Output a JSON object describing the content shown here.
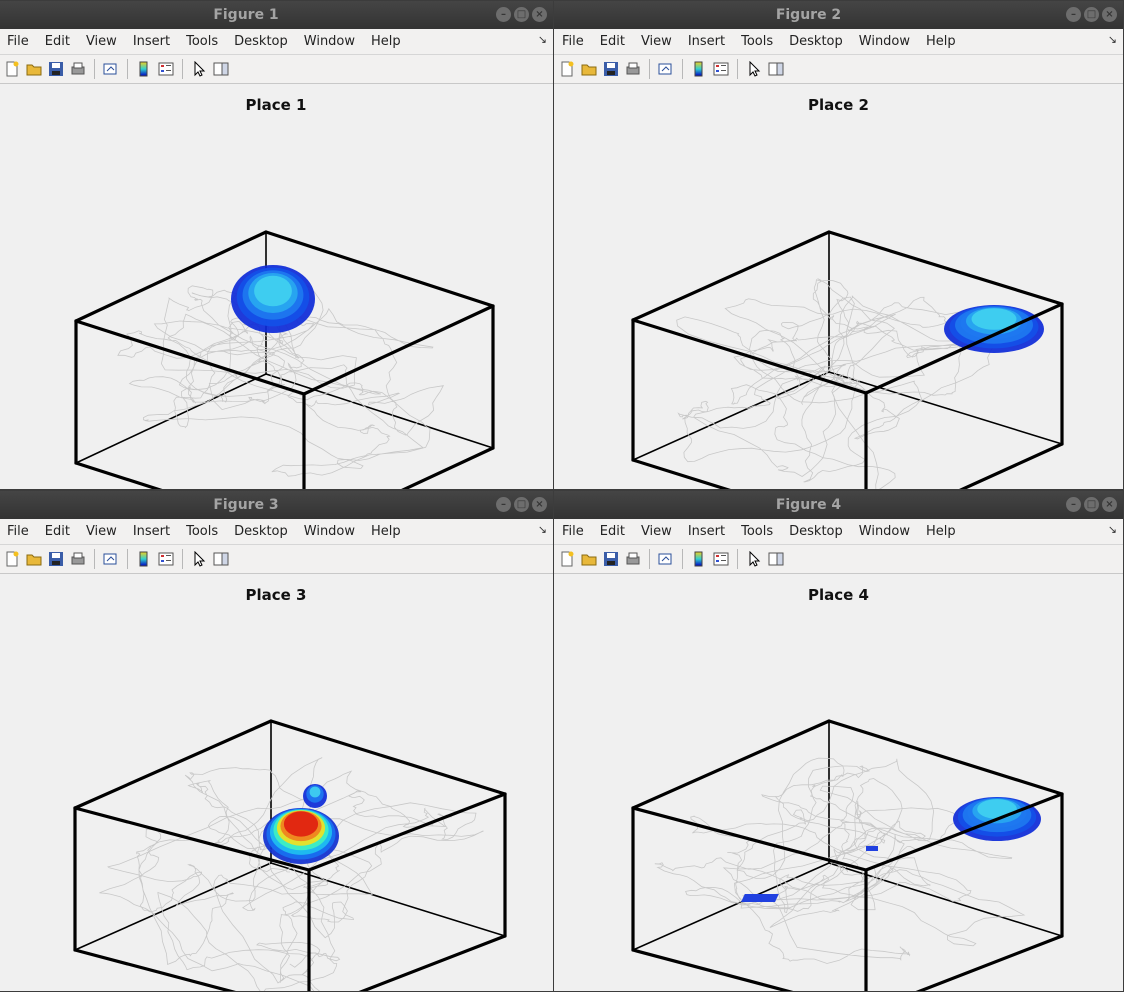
{
  "menu": [
    "File",
    "Edit",
    "View",
    "Insert",
    "Tools",
    "Desktop",
    "Window",
    "Help"
  ],
  "window_buttons": {
    "minimize": "–",
    "maximize": "□",
    "close": "×"
  },
  "toolbar_icons": [
    "new-figure-icon",
    "open-file-icon",
    "save-icon",
    "print-icon",
    "link-plot-icon",
    "colorbar-icon",
    "legend-icon",
    "pointer-icon",
    "property-editor-icon"
  ],
  "figures": [
    {
      "window_title": "Figure 1",
      "plot_title": "Place 1"
    },
    {
      "window_title": "Figure 2",
      "plot_title": "Place 2"
    },
    {
      "window_title": "Figure 3",
      "plot_title": "Place 3"
    },
    {
      "window_title": "Figure 4",
      "plot_title": "Place 4"
    }
  ],
  "colors": {
    "trajectory": "#c8c8c8",
    "box": "#000000",
    "titlebar_text": "#a4a4a4"
  }
}
